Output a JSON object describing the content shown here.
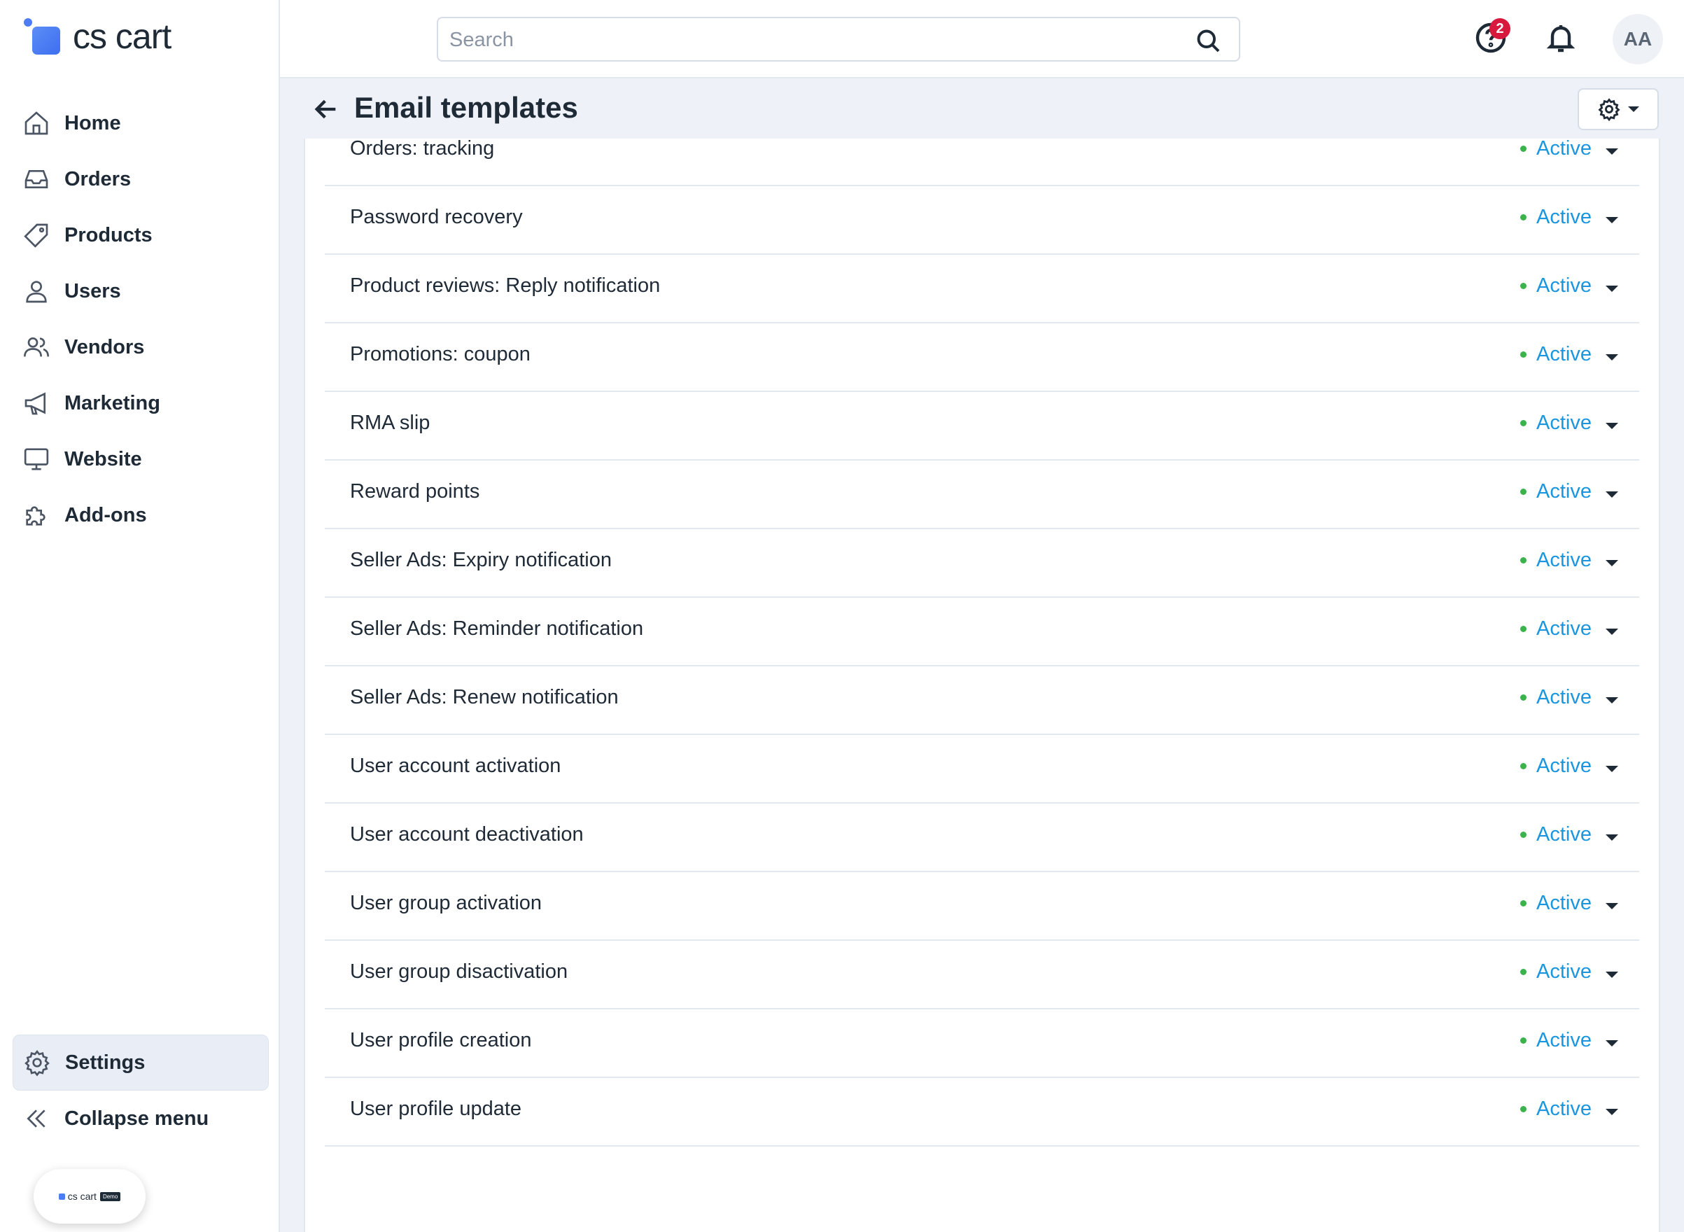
{
  "app": {
    "logo_text": "cs cart"
  },
  "sidebar": {
    "items": [
      {
        "label": "Home",
        "icon": "home-icon"
      },
      {
        "label": "Orders",
        "icon": "inbox-icon"
      },
      {
        "label": "Products",
        "icon": "tag-icon"
      },
      {
        "label": "Users",
        "icon": "user-icon"
      },
      {
        "label": "Vendors",
        "icon": "users-icon"
      },
      {
        "label": "Marketing",
        "icon": "megaphone-icon"
      },
      {
        "label": "Website",
        "icon": "monitor-icon"
      },
      {
        "label": "Add-ons",
        "icon": "puzzle-icon"
      }
    ],
    "settings_label": "Settings",
    "collapse_label": "Collapse menu",
    "demo_badge": {
      "text": "cs cart",
      "tag": "Demo"
    }
  },
  "header": {
    "search_placeholder": "Search",
    "help_badge_count": "2",
    "avatar_initials": "AA"
  },
  "page": {
    "title": "Email templates"
  },
  "templates": [
    {
      "name": "Orders: tracking",
      "status": "Active"
    },
    {
      "name": "Password recovery",
      "status": "Active"
    },
    {
      "name": "Product reviews: Reply notification",
      "status": "Active"
    },
    {
      "name": "Promotions: coupon",
      "status": "Active"
    },
    {
      "name": "RMA slip",
      "status": "Active"
    },
    {
      "name": "Reward points",
      "status": "Active"
    },
    {
      "name": "Seller Ads: Expiry notification",
      "status": "Active"
    },
    {
      "name": "Seller Ads: Reminder notification",
      "status": "Active"
    },
    {
      "name": "Seller Ads: Renew notification",
      "status": "Active"
    },
    {
      "name": "User account activation",
      "status": "Active"
    },
    {
      "name": "User account deactivation",
      "status": "Active"
    },
    {
      "name": "User group activation",
      "status": "Active"
    },
    {
      "name": "User group disactivation",
      "status": "Active"
    },
    {
      "name": "User profile creation",
      "status": "Active"
    },
    {
      "name": "User profile update",
      "status": "Active"
    }
  ],
  "colors": {
    "status_active": "#1a96e0",
    "status_dot": "#3bb34a",
    "badge": "#d7193e",
    "accent": "#4d7cf5"
  }
}
